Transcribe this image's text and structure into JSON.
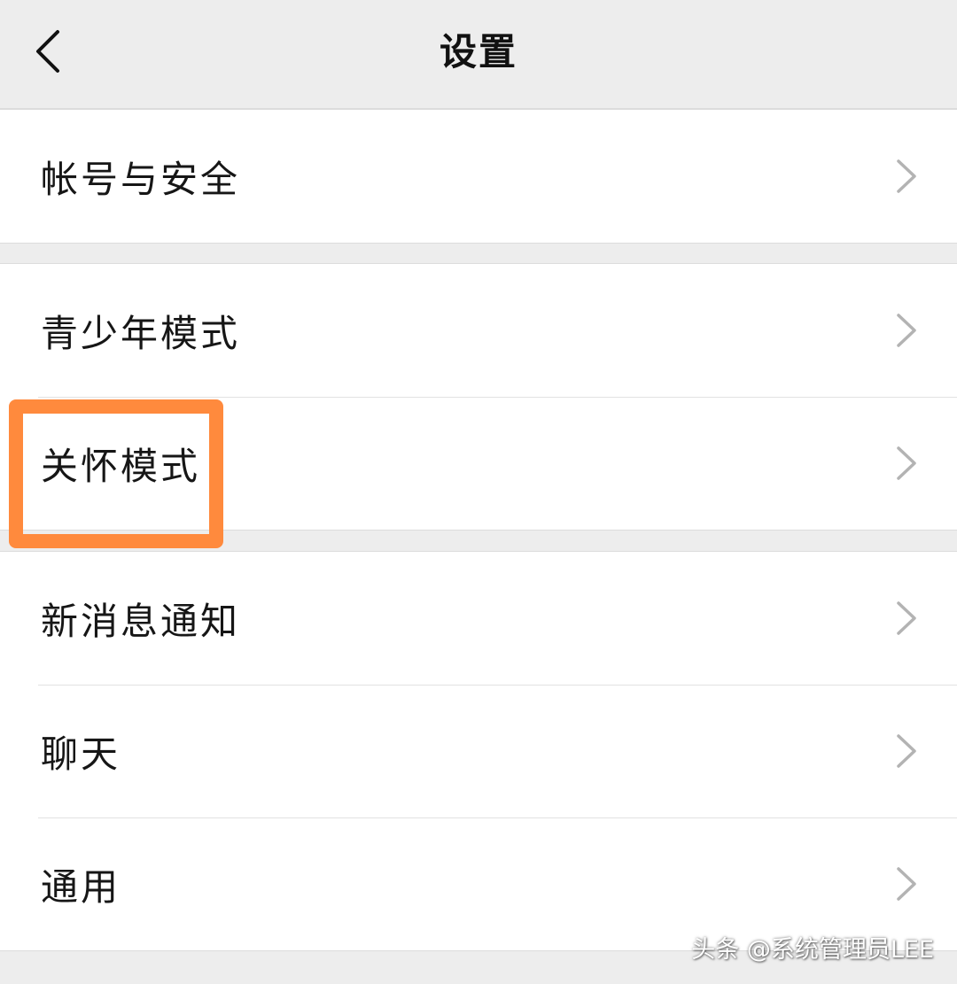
{
  "header": {
    "title": "设置",
    "back_icon": "chevron-left-icon"
  },
  "groups": [
    {
      "items": [
        {
          "label": "帐号与安全",
          "icon": "chevron-right-icon"
        }
      ]
    },
    {
      "items": [
        {
          "label": "青少年模式",
          "icon": "chevron-right-icon"
        },
        {
          "label": "关怀模式",
          "icon": "chevron-right-icon",
          "highlighted": true
        }
      ]
    },
    {
      "items": [
        {
          "label": "新消息通知",
          "icon": "chevron-right-icon"
        },
        {
          "label": "聊天",
          "icon": "chevron-right-icon"
        },
        {
          "label": "通用",
          "icon": "chevron-right-icon"
        }
      ]
    }
  ],
  "highlight_color": "#ff8a3d",
  "watermark": "头条 @系统管理员LEE"
}
